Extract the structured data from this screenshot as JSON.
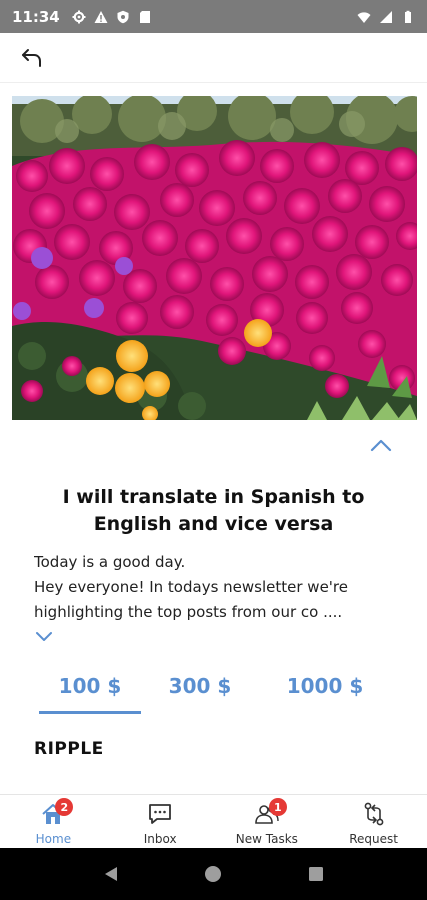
{
  "status_bar": {
    "time": "11:34"
  },
  "gig": {
    "title": "I will translate in Spanish to English and vice versa",
    "description_lines": [
      "Today is a good day.",
      "Hey everyone! In todays newsletter we're",
      "highlighting the top posts from our co  ...."
    ]
  },
  "price_tabs": [
    {
      "label": "100 $",
      "selected": true
    },
    {
      "label": "300 $",
      "selected": false
    },
    {
      "label": "1000 $",
      "selected": false
    }
  ],
  "section": {
    "title": "RIPPLE"
  },
  "bottom_nav": [
    {
      "label": "Home",
      "icon": "home-icon",
      "badge": "2",
      "active": true
    },
    {
      "label": "Inbox",
      "icon": "chat-icon",
      "badge": null,
      "active": false
    },
    {
      "label": "New Tasks",
      "icon": "users-icon",
      "badge": "1",
      "active": false
    },
    {
      "label": "Request",
      "icon": "git-compare-icon",
      "badge": null,
      "active": false
    }
  ],
  "colors": {
    "accent": "#5a8fd0",
    "badge": "#e53935",
    "status_bar": "#7b7b7b",
    "carousel_dot": "#1e88e5"
  },
  "carousel": {
    "slide_count": 1,
    "active_index": 0
  }
}
